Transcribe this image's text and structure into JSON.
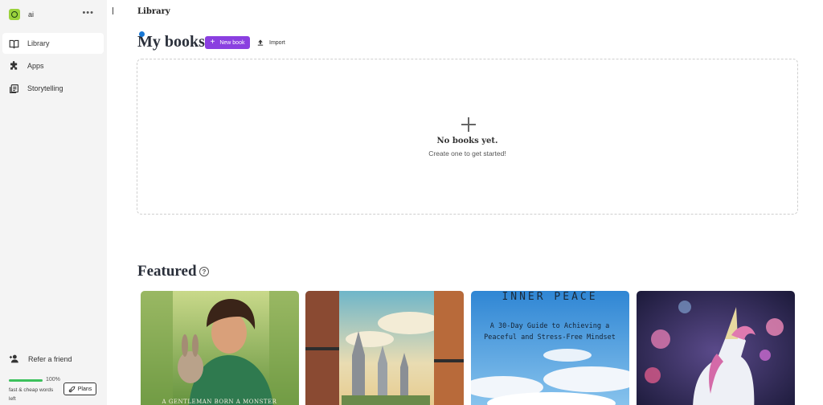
{
  "sidebar": {
    "workspace_name": "ai",
    "more": "•••",
    "items": [
      {
        "label": "Library",
        "icon": "book-icon",
        "active": true
      },
      {
        "label": "Apps",
        "icon": "puzzle-icon",
        "active": false
      },
      {
        "label": "Storytelling",
        "icon": "storytelling-icon",
        "active": false
      }
    ],
    "refer_label": "Refer a friend",
    "usage": {
      "percent": "100%",
      "fill_fraction": 1.0,
      "words_label": "fast & cheap words left"
    },
    "plans_label": "Plans"
  },
  "header": {
    "breadcrumb": "Library"
  },
  "my_books": {
    "title": "My books",
    "new_book_label": "New book",
    "import_label": "Import",
    "empty_title": "No books yet.",
    "empty_subtitle": "Create one to get started!"
  },
  "featured": {
    "title": "Featured",
    "cards": [
      {
        "title": "A GENTLEMAN BORN A MONSTER"
      },
      {
        "title": ""
      },
      {
        "title": "INNER PEACE",
        "subtitle": "A 30-Day Guide to Achieving a Peaceful and Stress-Free Mindset"
      },
      {
        "title": ""
      }
    ]
  },
  "colors": {
    "accent": "#8a3fe0",
    "progress": "#3cc15c",
    "dot": "#1877d4"
  }
}
